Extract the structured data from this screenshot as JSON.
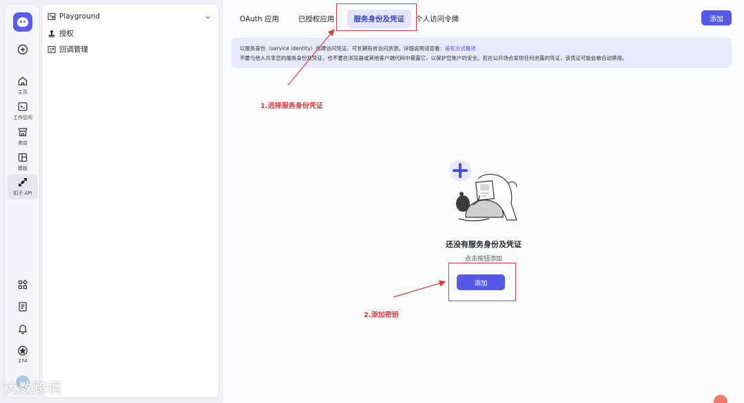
{
  "rail": {
    "items": [
      {
        "label": "主页"
      },
      {
        "label": "工作空间"
      },
      {
        "label": "商店"
      },
      {
        "label": "模板"
      },
      {
        "label": "扣子 API"
      }
    ],
    "star_count": "274"
  },
  "sidebar": {
    "items": [
      {
        "label": "Playground"
      },
      {
        "label": "授权"
      },
      {
        "label": "回调管理"
      }
    ]
  },
  "tabs": [
    {
      "label": "OAuth 应用"
    },
    {
      "label": "已授权应用"
    },
    {
      "label": "服务身份及凭证"
    },
    {
      "label": "个人访问令牌"
    }
  ],
  "header": {
    "add_label": "添加"
  },
  "notice": {
    "line1": "以服务身份（service identity）创建访问凭证，可长期有效访问资源。详细说明请查看：",
    "link": "鉴权方式概述",
    "line2": "不要与他人共享您的服务身份及凭证，也不要在浏览器或其他客户端代码中暴露它，以保护您账户的安全。若在公开场合发现任何泄露的凭证，该凭证可能会被自动禁用。"
  },
  "empty": {
    "title": "还没有服务身份及凭证",
    "subtitle": "点击按钮添加",
    "add_label": "添加"
  },
  "annotations": {
    "step1": "1.选择服务身份凭证",
    "step2": "2.添加密钥",
    "color": "#e23a3a"
  },
  "watermark": "大数跨境",
  "colors": {
    "accent": "#5558e8",
    "tab_active_bg": "#e3e6fb",
    "notice_bg": "#e8eafb"
  }
}
